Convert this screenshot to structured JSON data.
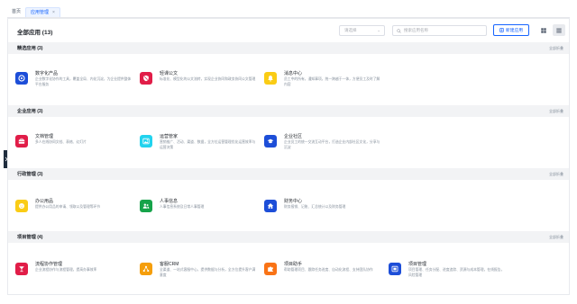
{
  "tabs": [
    {
      "label": "首页",
      "active": false
    },
    {
      "label": "应用管理",
      "active": true,
      "close": "×"
    }
  ],
  "toolbar": {
    "title": "全部应用 (13)",
    "select_placeholder": "请选择",
    "search_placeholder": "搜索应用名称",
    "new_button": "新建应用"
  },
  "colors": {
    "accent": "#1664ff",
    "section_bg": "#f2f3f5"
  },
  "sections": [
    {
      "title": "精选应用 (3)",
      "more": "全部折叠",
      "apps": [
        {
          "name": "数字化产品",
          "desc": "企业数字化协作的工具，覆盖全局、内化沉淀，为企业提供整体平台服务",
          "color": "#1d4ed8",
          "icon": "target-icon"
        },
        {
          "name": "轻课公文",
          "desc": "标准化、模型化的公文流转，实现企业协同和政务协同公文管理",
          "color": "#e11d48",
          "icon": "shield-icon"
        },
        {
          "name": "消息中心",
          "desc": "员工中的所有，通知事项，统一跨越于一体，方便员工及时了解内容",
          "color": "#facc15",
          "icon": "bell-icon"
        }
      ]
    },
    {
      "title": "企业应用 (3)",
      "more": "全部折叠",
      "apps": [
        {
          "name": "文档管理",
          "desc": "多人在线协同文档、表格、幻灯片",
          "color": "#e11d48",
          "icon": "briefcase-icon"
        },
        {
          "name": "运营管家",
          "desc": "营销推广、活动、渠道、数据，全方位运营管理优化运营效率与运营决策",
          "color": "#22d3ee",
          "icon": "image-icon"
        },
        {
          "name": "企业社区",
          "desc": "企业员工的统一交流互动平台，打造企业内部社区文化，分享与沉淀",
          "color": "#1d4ed8",
          "icon": "graduation-cap-icon"
        }
      ]
    },
    {
      "title": "行政管理 (3)",
      "more": "全部折叠",
      "apps": [
        {
          "name": "办公用品",
          "desc": "提供办公用品的申请、领取以及管理等环节",
          "color": "#facc15",
          "icon": "smiley-icon"
        },
        {
          "name": "人事信息",
          "desc": "人事信息系统及日常人事管理",
          "color": "#16a34a",
          "icon": "users-icon"
        },
        {
          "name": "财务中心",
          "desc": "财务报销、记账、汇总统计以及财务管理",
          "color": "#1d4ed8",
          "icon": "home-icon"
        }
      ]
    },
    {
      "title": "项目管理 (4)",
      "more": "全部折叠",
      "apps": [
        {
          "name": "流程协作管理",
          "desc": "企业流程协作与流程管理，提高办事效率",
          "color": "#e11d48",
          "icon": "cocktail-icon"
        },
        {
          "name": "客服CRM",
          "desc": "全渠道、一站式客服中心，提供数据与分析，全方位提升客户满意度",
          "color": "#f59e0b",
          "icon": "nodes-icon"
        },
        {
          "name": "项目助手",
          "desc": "帮助管理项目、跟踪任务进度、自动化流程、支持团队协作",
          "color": "#f97316",
          "icon": "puzzle-icon"
        },
        {
          "name": "项目管理",
          "desc": "项目管理、任务分配、进度追踪、资源与成本管理，在线报告，风险管理",
          "color": "#1d4ed8",
          "icon": "board-icon"
        }
      ]
    }
  ]
}
